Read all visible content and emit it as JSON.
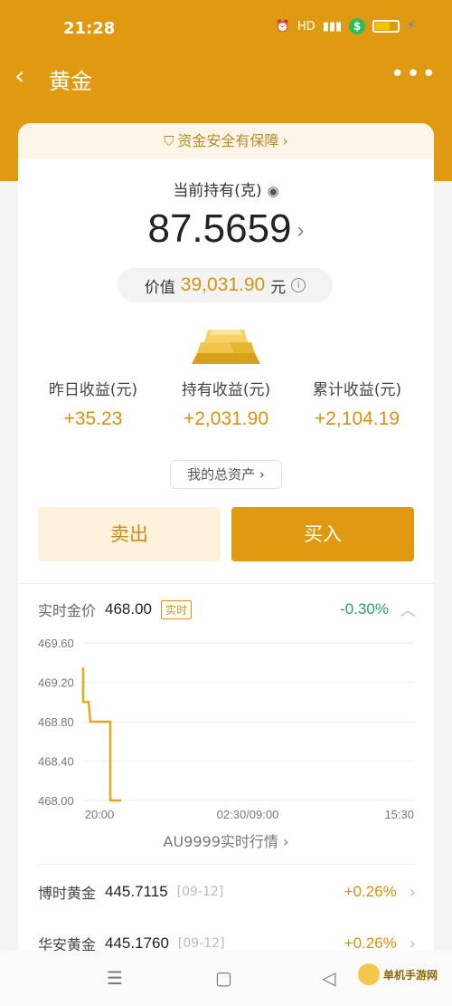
{
  "status_bar": {
    "time": "21:28",
    "hd": "HD",
    "signal": "⁴ᴳ"
  },
  "header": {
    "title": "黄金"
  },
  "safety_banner": {
    "text": "资金安全有保障"
  },
  "holding": {
    "label": "当前持有(克)",
    "amount": "87.5659",
    "value_label": "价值",
    "value": "39,031.90",
    "value_unit": "元"
  },
  "earnings": [
    {
      "label": "昨日收益(元)",
      "value": "+35.23"
    },
    {
      "label": "持有收益(元)",
      "value": "+2,031.90"
    },
    {
      "label": "累计收益(元)",
      "value": "+2,104.19"
    }
  ],
  "assets_button": "我的总资产",
  "actions": {
    "sell": "卖出",
    "buy": "买入"
  },
  "realtime": {
    "label": "实时金价",
    "price": "468.00",
    "tag": "实时",
    "change": "-0.30%"
  },
  "chart_data": {
    "type": "line",
    "ylim": [
      468.0,
      469.6
    ],
    "y_ticks": [
      "469.60",
      "469.20",
      "468.80",
      "468.40",
      "468.00"
    ],
    "x_ticks": [
      "20:00",
      "02:30/09:00",
      "15:30"
    ],
    "series": [
      {
        "color": "#e0a81a",
        "points": [
          {
            "x": "20:00",
            "y": 469.35
          },
          {
            "x": "20:00",
            "y": 469.0
          },
          {
            "x": "20:00",
            "y": 468.8
          },
          {
            "x": "20:00",
            "y": 468.75
          },
          {
            "x": "20:00",
            "y": 468.0
          }
        ]
      }
    ]
  },
  "au_link": "AU9999实时行情",
  "funds": [
    {
      "name": "博时黄金",
      "nav": "445.7115",
      "date": "[09-12]",
      "change": "+0.26%"
    },
    {
      "name": "华安黄金",
      "nav": "445.1760",
      "date": "[09-12]",
      "change": "+0.26%"
    }
  ],
  "watermark": "单机手游网",
  "colors": {
    "brand": "#e09a12",
    "gain": "#d4930e",
    "loss": "#2aa06a"
  }
}
